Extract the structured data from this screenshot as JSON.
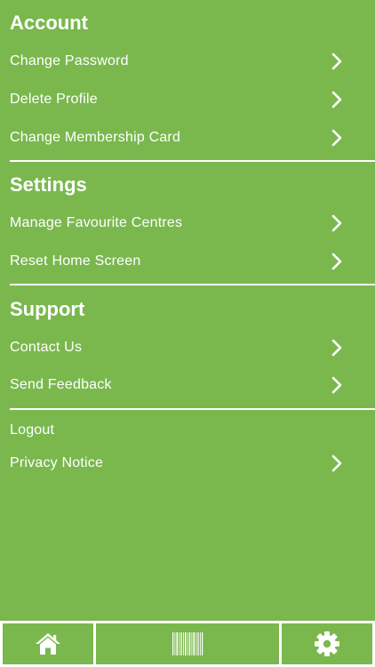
{
  "account": {
    "title": "Account",
    "items": [
      {
        "label": "Change Password"
      },
      {
        "label": "Delete Profile"
      },
      {
        "label": "Change Membership Card"
      }
    ]
  },
  "settings": {
    "title": "Settings",
    "items": [
      {
        "label": "Manage Favourite Centres"
      },
      {
        "label": "Reset Home Screen"
      }
    ]
  },
  "support": {
    "title": "Support",
    "items": [
      {
        "label": "Contact Us"
      },
      {
        "label": "Send Feedback"
      }
    ]
  },
  "misc": {
    "items": [
      {
        "label": "Logout"
      },
      {
        "label": "Privacy Notice"
      }
    ]
  },
  "tabbar": {
    "tabs": [
      {
        "icon": "home-icon"
      },
      {
        "icon": "barcode-icon"
      },
      {
        "icon": "gear-icon"
      }
    ]
  },
  "colors": {
    "background": "#7ab84e",
    "text": "#ffffff",
    "divider": "#ffffff"
  }
}
